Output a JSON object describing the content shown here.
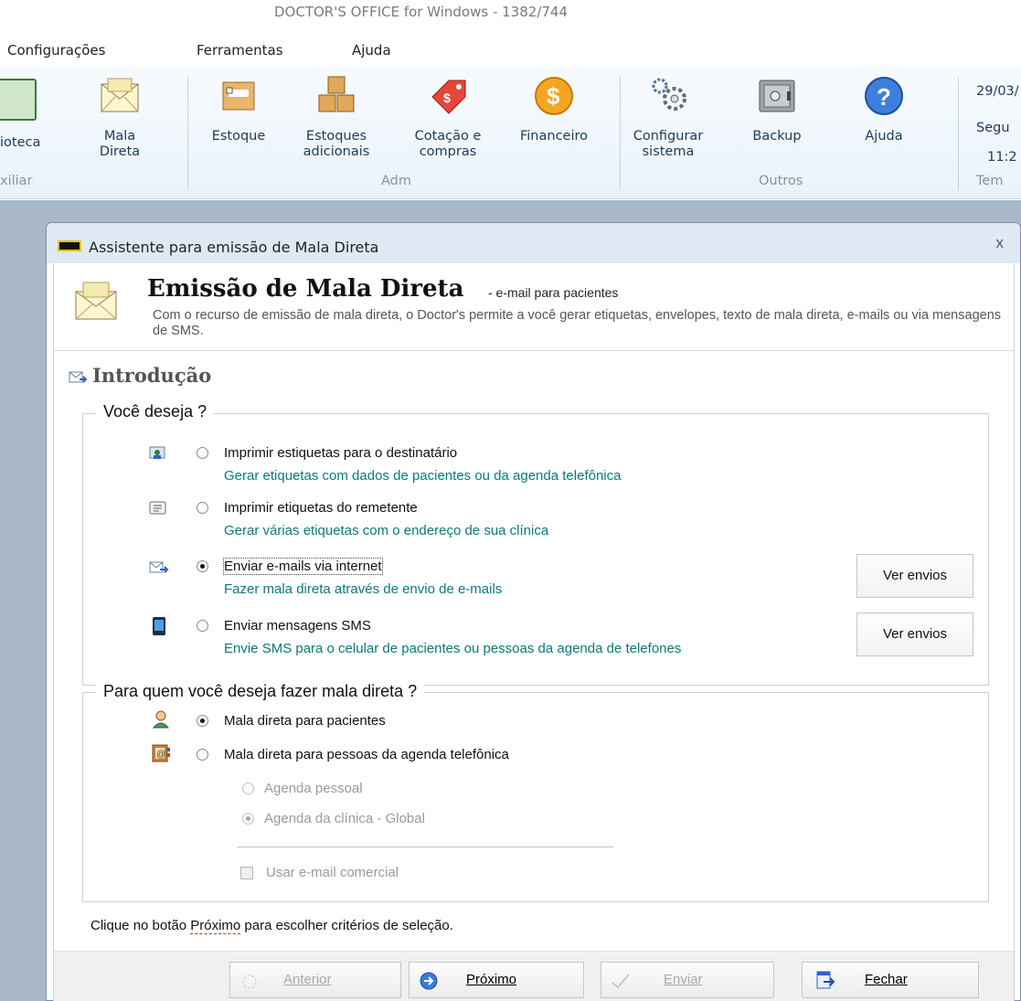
{
  "window": {
    "title": "DOCTOR'S OFFICE for Windows    - 1382/744"
  },
  "menu": [
    "Configurações",
    "Ferramentas",
    "Ajuda"
  ],
  "ribbon": {
    "left_partial": "ioteca",
    "left_group_partial": "xiliar",
    "buttons": [
      {
        "label": "Mala\nDireta",
        "icon": "envelope-icon"
      },
      {
        "label": "Estoque",
        "icon": "box-icon"
      },
      {
        "label": "Estoques\nadicionais",
        "icon": "boxes-icon"
      },
      {
        "label": "Cotação e\ncompras",
        "icon": "price-tag-icon"
      },
      {
        "label": "Financeiro",
        "icon": "dollar-coin-icon"
      },
      {
        "label": "Configurar\nsistema",
        "icon": "gears-icon"
      },
      {
        "label": "Backup",
        "icon": "safe-icon"
      },
      {
        "label": "Ajuda",
        "icon": "help-icon"
      }
    ],
    "groups": [
      "Adm",
      "Outros"
    ],
    "right": {
      "date": "29/03/",
      "day": "Segu",
      "time": "11:2",
      "group": "Tem"
    }
  },
  "dialog": {
    "title": "Assistente para emissão de Mala Direta",
    "close": "x",
    "heading": "Emissão de Mala Direta",
    "heading_sub": "- e-mail para pacientes",
    "description": "Com o recurso de emissão de mala direta, o Doctor's permite a você gerar etiquetas, envelopes, texto de mala direta, e-mails ou via mensagens de SMS.",
    "section": "Introdução",
    "group1": {
      "legend": "Você deseja ?",
      "options": [
        {
          "label": "Imprimir estiquetas para o destinatário",
          "sub": "Gerar etiquetas com dados de pacientes ou da agenda telefônica",
          "checked": false
        },
        {
          "label": "Imprimir etiquetas do remetente",
          "sub": "Gerar várias etiquetas com o endereço de sua clínica",
          "checked": false
        },
        {
          "label": "Enviar e-mails via internet",
          "sub": "Fazer mala direta através de envio de e-mails",
          "checked": true
        },
        {
          "label": "Enviar mensagens SMS",
          "sub": "Envie SMS para o celular de pacientes ou pessoas da agenda de telefones",
          "checked": false
        }
      ],
      "ver_envios": "Ver envios"
    },
    "group2": {
      "legend": "Para quem você deseja fazer mala direta ?",
      "patients": "Mala direta para pacientes",
      "phonebook": "Mala direta para pessoas da agenda telefônica",
      "personal": "Agenda pessoal",
      "global": "Agenda da clínica - Global",
      "business_email": "Usar e-mail comercial"
    },
    "hint_pre": "Clique no botão ",
    "hint_word": "Próximo",
    "hint_post": " para escolher critérios de seleção.",
    "buttons": {
      "previous": "Anterior",
      "next": "Próximo",
      "send": "Enviar",
      "close": "Fechar"
    }
  }
}
